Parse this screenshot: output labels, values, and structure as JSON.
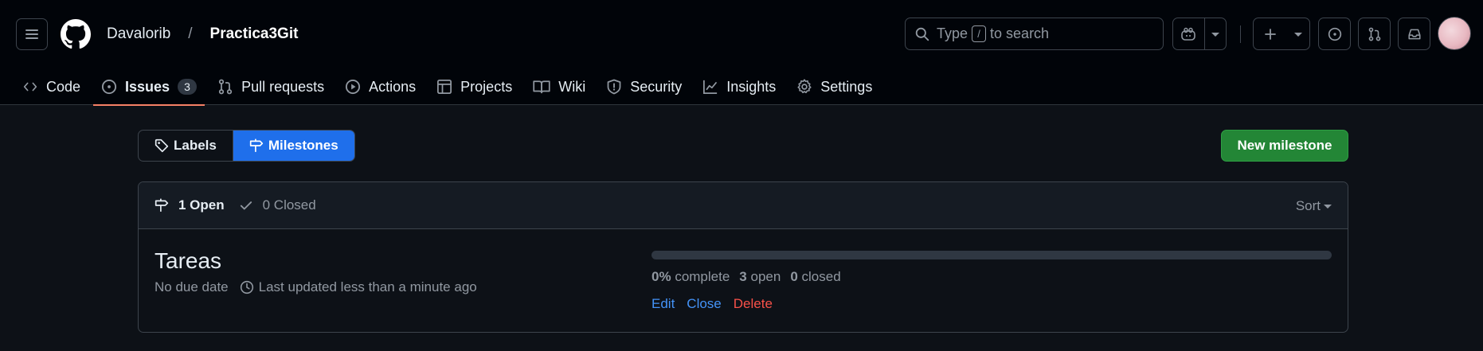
{
  "header": {
    "owner": "Davalorib",
    "separator": "/",
    "repo": "Practica3Git",
    "search": {
      "prefix": "Type",
      "key": "/",
      "suffix": "to search"
    }
  },
  "tabs": [
    {
      "label": "Code",
      "icon": "code-icon"
    },
    {
      "label": "Issues",
      "icon": "issue-opened-icon",
      "count": "3",
      "active": true
    },
    {
      "label": "Pull requests",
      "icon": "git-pull-request-icon"
    },
    {
      "label": "Actions",
      "icon": "play-icon"
    },
    {
      "label": "Projects",
      "icon": "table-icon"
    },
    {
      "label": "Wiki",
      "icon": "book-icon"
    },
    {
      "label": "Security",
      "icon": "shield-icon"
    },
    {
      "label": "Insights",
      "icon": "graph-icon"
    },
    {
      "label": "Settings",
      "icon": "gear-icon"
    }
  ],
  "toggle": {
    "labels": "Labels",
    "milestones": "Milestones"
  },
  "new_milestone": "New milestone",
  "list": {
    "open_label": "1 Open",
    "closed_label": "0 Closed",
    "sort_label": "Sort"
  },
  "milestones": [
    {
      "title": "Tareas",
      "due": "No due date",
      "updated": "Last updated less than a minute ago",
      "progress_fraction": 0,
      "percent": "0%",
      "complete_label": "complete",
      "open_count": "3",
      "open_label": "open",
      "closed_count": "0",
      "closed_label": "closed",
      "edit": "Edit",
      "close": "Close",
      "delete": "Delete"
    }
  ],
  "colors": {
    "accent": "#1f6feb",
    "primary_button": "#238636",
    "active_tab_underline": "#f78166",
    "link": "#4493f8",
    "danger": "#f85149"
  }
}
